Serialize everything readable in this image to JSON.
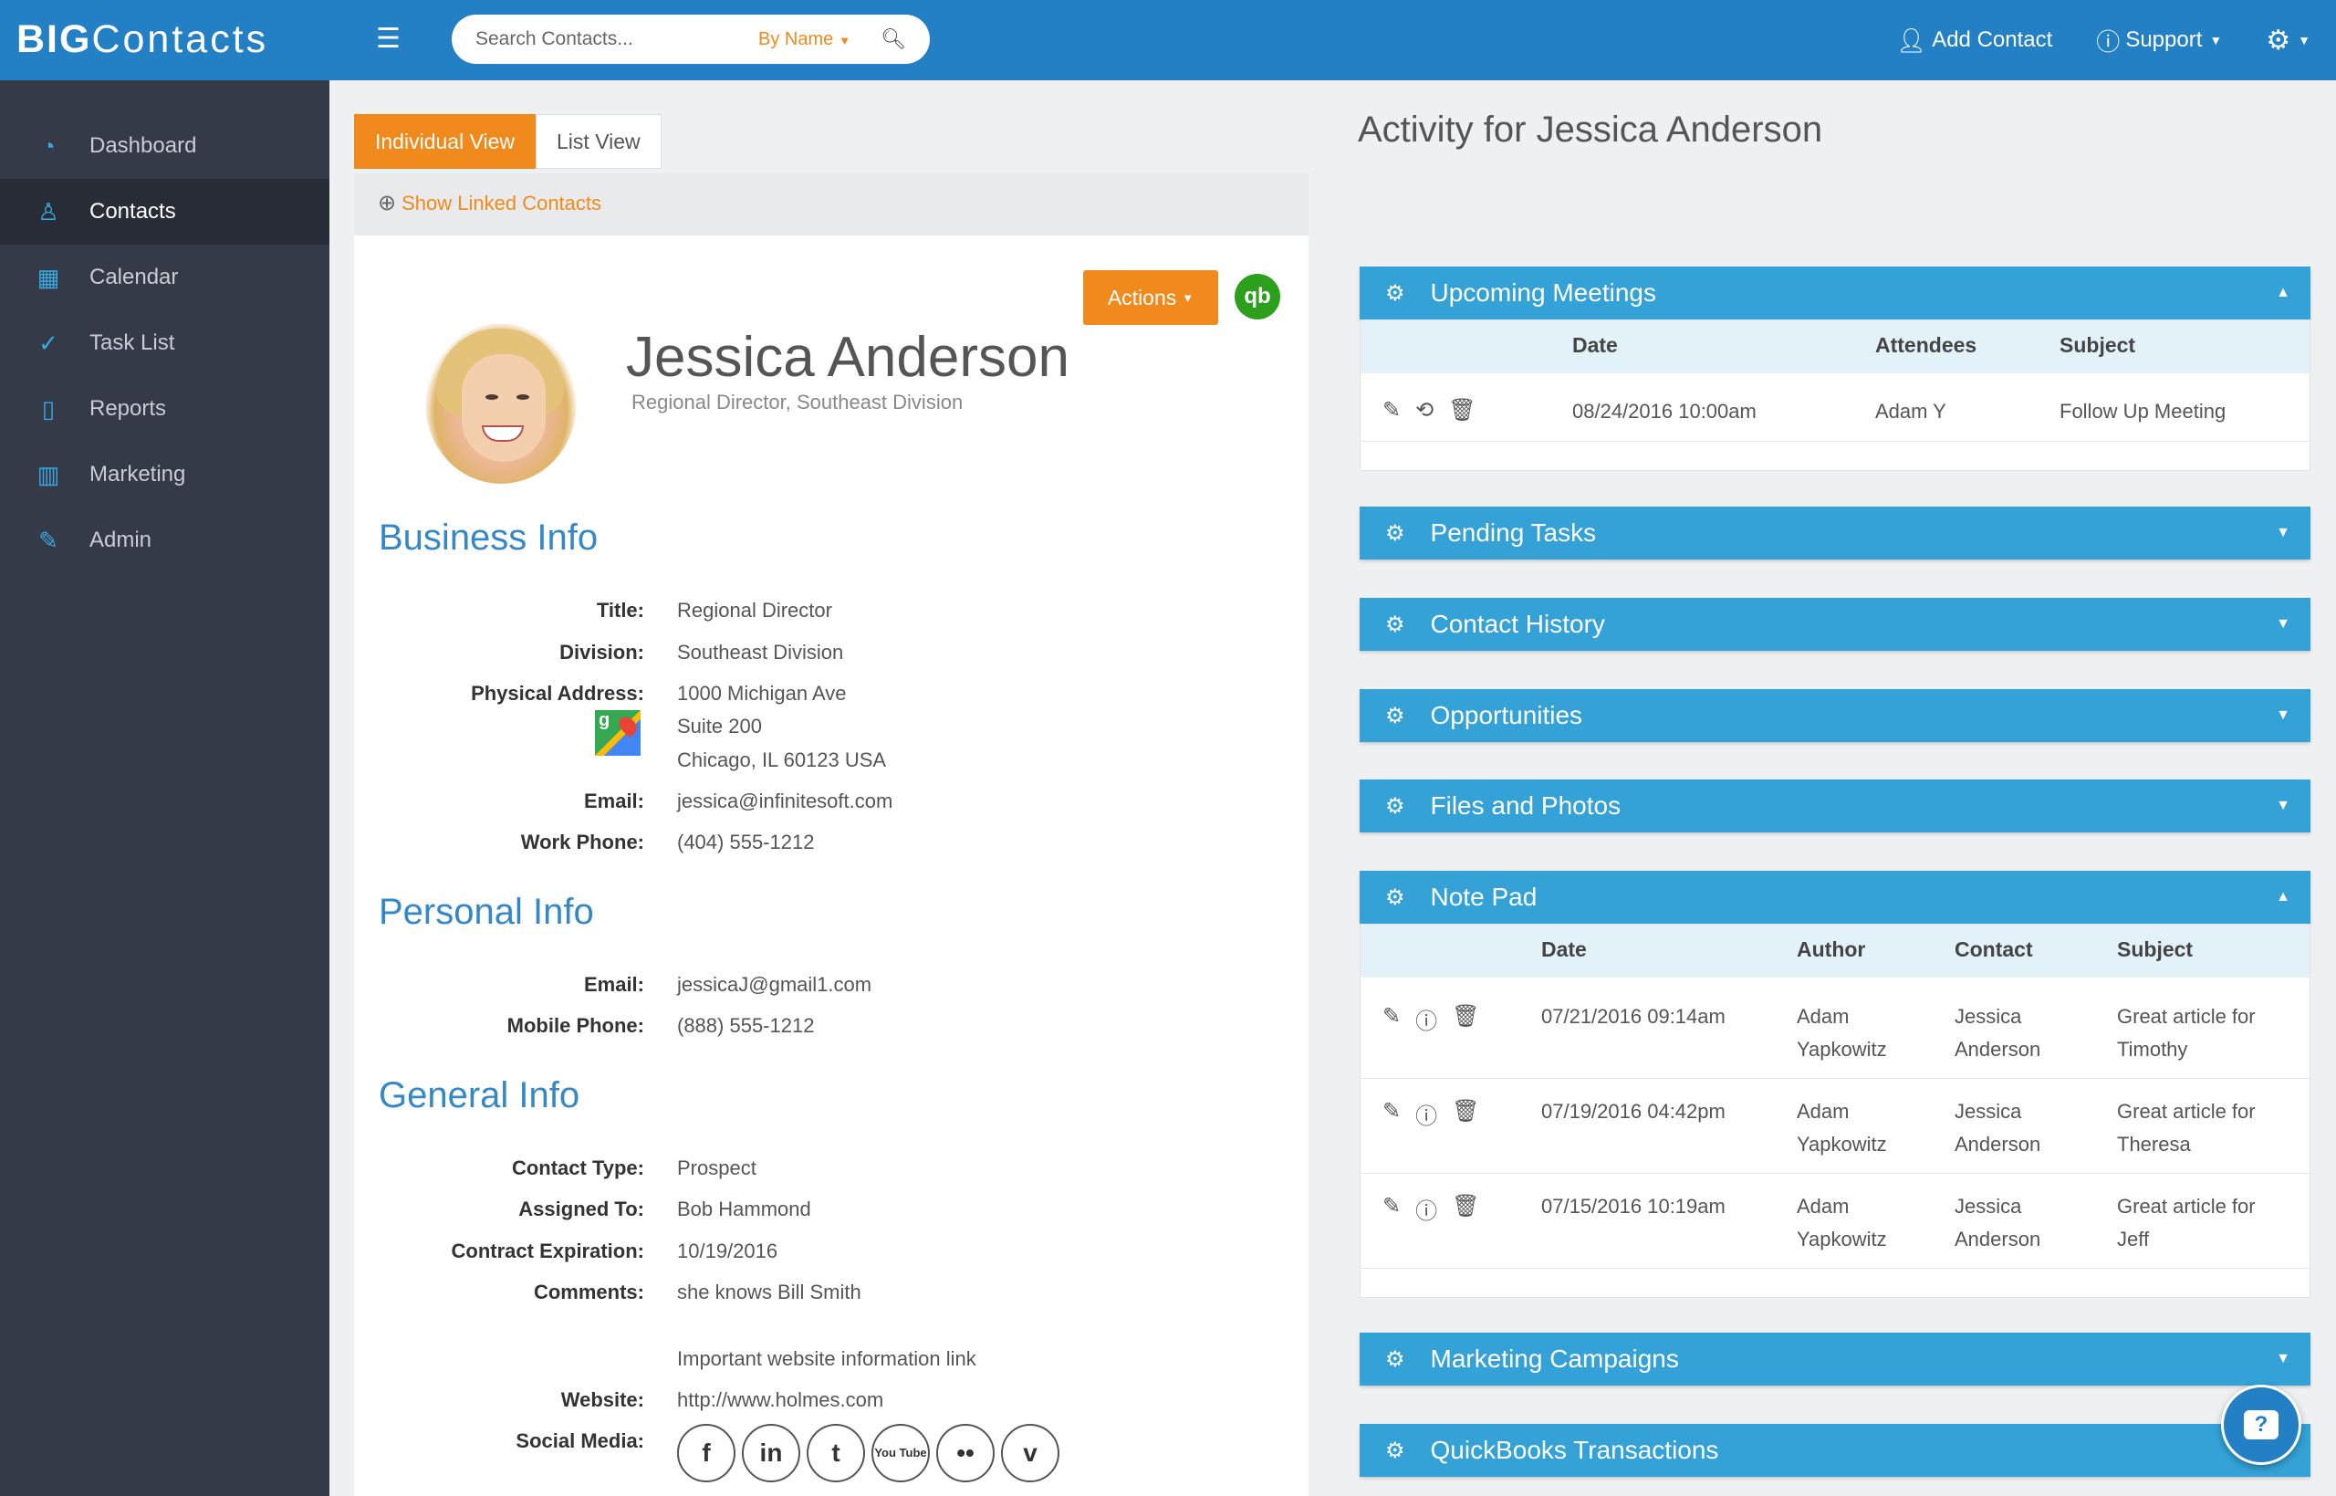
{
  "app": {
    "logo_big": "BIG",
    "logo_contacts": "Contacts"
  },
  "search": {
    "placeholder": "Search Contacts...",
    "mode": "By Name"
  },
  "top_nav": {
    "add_contact": "Add Contact",
    "support": "Support"
  },
  "sidebar": {
    "items": [
      {
        "label": "Dashboard",
        "icon": "gauge-icon"
      },
      {
        "label": "Contacts",
        "icon": "user-icon"
      },
      {
        "label": "Calendar",
        "icon": "calendar-icon"
      },
      {
        "label": "Task List",
        "icon": "check-circle-icon"
      },
      {
        "label": "Reports",
        "icon": "document-icon"
      },
      {
        "label": "Marketing",
        "icon": "bar-chart-icon"
      },
      {
        "label": "Admin",
        "icon": "wrench-icon"
      }
    ],
    "active": "Contacts"
  },
  "view_tabs": {
    "individual": "Individual View",
    "list": "List View"
  },
  "linked_contacts": "Show Linked Contacts",
  "contact": {
    "actions": "Actions",
    "qb": "qb",
    "name": "Jessica Anderson",
    "subtitle": "Regional Director,  Southeast Division"
  },
  "business_info": {
    "title": "Business Info",
    "title_label": "Title:",
    "title_value": "Regional Director",
    "division_label": "Division:",
    "division_value": "Southeast Division",
    "address_label": "Physical Address:",
    "address_line1": "1000 Michigan Ave",
    "address_line2": "Suite 200",
    "address_line3": "Chicago, IL 60123 USA",
    "email_label": "Email:",
    "email_value": "jessica@infinitesoft.com",
    "work_phone_label": "Work Phone:",
    "work_phone_value": "(404) 555-1212"
  },
  "personal_info": {
    "title": "Personal Info",
    "email_label": "Email:",
    "email_value": "jessicaJ@gmail1.com",
    "mobile_label": "Mobile Phone:",
    "mobile_value": "(888) 555-1212"
  },
  "general_info": {
    "title": "General Info",
    "contact_type_label": "Contact Type:",
    "contact_type_value": "Prospect",
    "assigned_label": "Assigned To:",
    "assigned_value": "Bob Hammond",
    "contract_label": "Contract Expiration:",
    "contract_value": "10/19/2016",
    "comments_label": "Comments:",
    "comments_value": "she knows Bill Smith",
    "website_note": "Important website information link",
    "website_label": "Website:",
    "website_value": "http://www.holmes.com",
    "social_label": "Social Media:",
    "social": [
      "f",
      "in",
      "t",
      "You Tube",
      "••",
      "v"
    ]
  },
  "activity": {
    "title": "Activity for Jessica Anderson",
    "upcoming_meetings": {
      "label": "Upcoming Meetings",
      "headers": [
        "Date",
        "Attendees",
        "Subject"
      ],
      "rows": [
        {
          "date": "08/24/2016  10:00am",
          "attendees": "Adam Y",
          "subject": "Follow Up Meeting"
        }
      ]
    },
    "pending_tasks": "Pending Tasks",
    "contact_history": "Contact History",
    "opportunities": "Opportunities",
    "files_photos": "Files and Photos",
    "note_pad": {
      "label": "Note Pad",
      "headers": [
        "Date",
        "Author",
        "Contact",
        "Subject"
      ],
      "rows": [
        {
          "date": "07/21/2016  09:14am",
          "author": "Adam\nYapkowitz",
          "contact": "Jessica\nAnderson",
          "subject": "Great article for\nTimothy"
        },
        {
          "date": "07/19/2016  04:42pm",
          "author": "Adam\nYapkowitz",
          "contact": "Jessica\nAnderson",
          "subject": "Great article for\nTheresa"
        },
        {
          "date": "07/15/2016  10:19am",
          "author": "Adam\nYapkowitz",
          "contact": "Jessica\nAnderson",
          "subject": "Great article for\nJeff"
        }
      ]
    },
    "marketing_campaigns": "Marketing Campaigns",
    "quickbooks": "QuickBooks Transactions"
  },
  "colors": {
    "topbar": "#2380c4",
    "sidebar": "#343a48",
    "accent_orange": "#f08a1c",
    "panel_blue": "#34a2d6"
  }
}
